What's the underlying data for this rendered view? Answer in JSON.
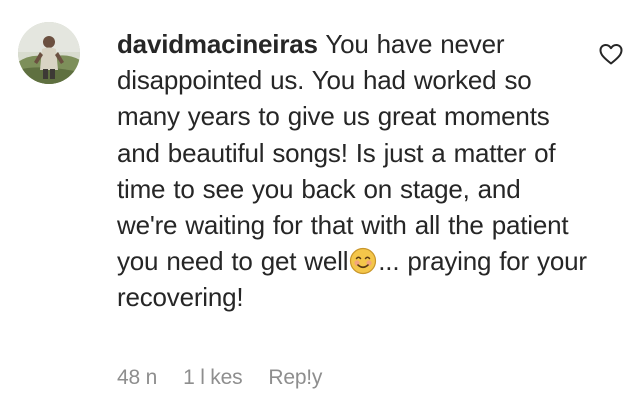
{
  "comment": {
    "username": "davidmacineiras",
    "text_before_emoji": "You have never disappointed us. You had worked so many years to give us great moments and beautiful songs! Is just a matter of time to see you back on stage, and we're waiting for that with all the patient you need to get well",
    "emoji": "smiling-face-icon",
    "text_after_emoji": "... praying for your recovering!",
    "time": "48 n",
    "likes": "1 l kes",
    "reply_label": "Rep!y"
  },
  "icons": {
    "like": "heart-outline-icon",
    "avatar": "user-avatar"
  },
  "colors": {
    "text": "#262626",
    "meta": "#8e8e8e",
    "emoji_face": "#f4c64a"
  }
}
